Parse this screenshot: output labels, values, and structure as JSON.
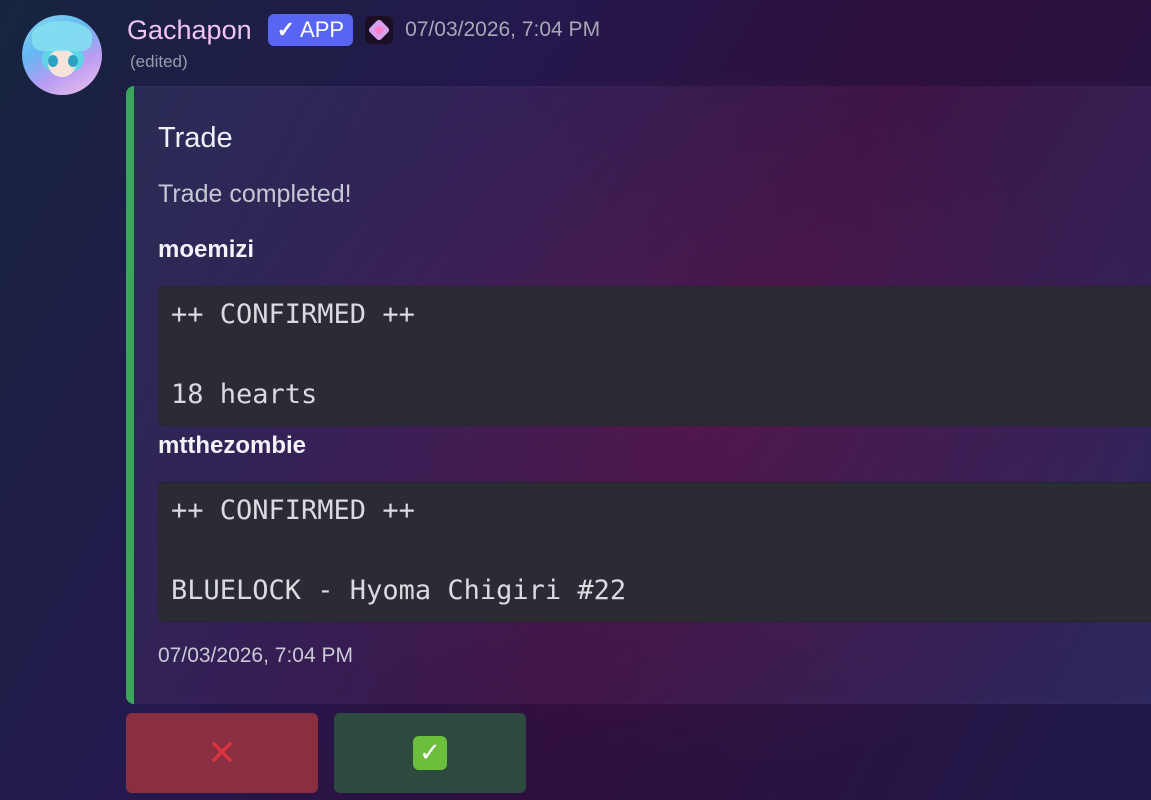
{
  "message": {
    "username": "Gachapon",
    "app_badge": {
      "check": "✓",
      "label": "APP"
    },
    "timestamp": "07/03/2026, 7:04 PM",
    "edited_label": "(edited)"
  },
  "embed": {
    "accent_color": "#3ba55c",
    "title": "Trade",
    "description": "Trade completed!",
    "fields": [
      {
        "name": "moemizi",
        "lines": [
          "++ CONFIRMED ++",
          "18 hearts"
        ]
      },
      {
        "name": "mtthezombie",
        "lines": [
          "++ CONFIRMED ++",
          "BLUELOCK - Hyoma Chigiri #22"
        ]
      }
    ],
    "footer_timestamp": "07/03/2026, 7:04 PM"
  },
  "buttons": {
    "reject": {
      "icon": "cross-mark-icon",
      "glyph": "✕",
      "color": "#8a2e42"
    },
    "accept": {
      "icon": "check-box-icon",
      "glyph": "✓",
      "color": "#2c4b3e"
    }
  }
}
